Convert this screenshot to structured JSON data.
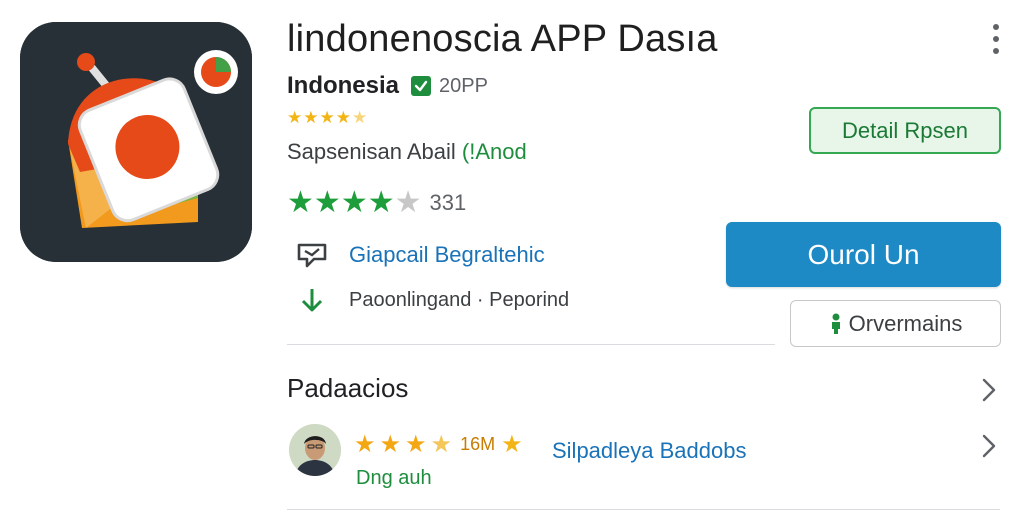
{
  "app": {
    "title": "lindonenoscia APP Dasıa",
    "developer": "Indonesia",
    "developer_extra": "20PP",
    "category_text": "Sapsenisan Abail",
    "category_link": "(!Anod",
    "rating_count": "331",
    "small_rating": 4.5,
    "rating": 4.5
  },
  "features": [
    {
      "icon": "chat-bubble-icon",
      "text": "Giapcail Begraltehic"
    },
    {
      "icon": "download-arrow-icon",
      "text": "Paoonlingand · Peporind"
    }
  ],
  "buttons": {
    "detail": "Detail Rpsen",
    "primary": "Ourol Un",
    "secondary": "Orvermains"
  },
  "section": {
    "title": "Padaacios"
  },
  "review": {
    "stars": 3.5,
    "count": "16M",
    "name": "Silpadleya Baddobs",
    "author": "Dng auh"
  },
  "colors": {
    "accent_green": "#1e8e3e",
    "primary_blue": "#1d8ac6",
    "link_blue": "#1a73b8",
    "star_gold": "#f3a712"
  }
}
